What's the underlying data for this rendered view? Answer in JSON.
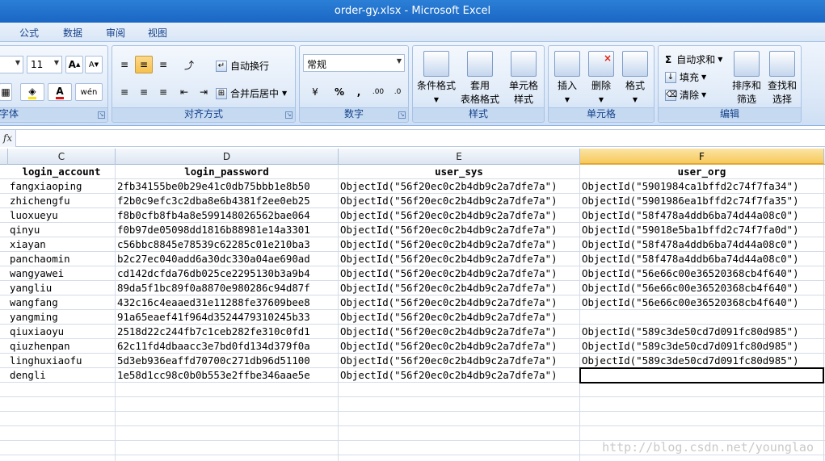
{
  "window": {
    "title": "order-gy.xlsx - Microsoft Excel"
  },
  "tabs": [
    "公式",
    "数据",
    "审阅",
    "视图"
  ],
  "ribbon": {
    "font": {
      "label": "字体",
      "size": "11"
    },
    "alignment": {
      "label": "对齐方式",
      "wrap_text": "自动换行",
      "merge_center": "合并后居中"
    },
    "number": {
      "label": "数字",
      "format": "常规"
    },
    "styles": {
      "label": "样式",
      "conditional": "条件格式",
      "table_format_1": "套用",
      "table_format_2": "表格格式",
      "cell_styles_1": "单元格",
      "cell_styles_2": "样式"
    },
    "cells": {
      "label": "单元格",
      "insert": "插入",
      "delete": "删除",
      "format": "格式"
    },
    "editing": {
      "label": "编辑",
      "autosum": "自动求和",
      "fill": "填充",
      "clear": "清除",
      "sort_filter_1": "排序和",
      "sort_filter_2": "筛选",
      "find_select_1": "查找和",
      "find_select_2": "选择"
    }
  },
  "formula_bar": {
    "fx": "fx",
    "content": ""
  },
  "columns": [
    "C",
    "D",
    "E",
    "F"
  ],
  "active_column": "F",
  "header_row": [
    "login_account",
    "login_password",
    "user_sys",
    "user_org"
  ],
  "rows": [
    [
      "fangxiaoping",
      "2fb34155be0b29e41c0db75bbb1e8b50",
      "ObjectId(\"56f20ec0c2b4db9c2a7dfe7a\")",
      "ObjectId(\"5901984ca1bffd2c74f7fa34\")"
    ],
    [
      "zhichengfu",
      "f2b0c9efc3c2dba8e6b4381f2ee0eb25",
      "ObjectId(\"56f20ec0c2b4db9c2a7dfe7a\")",
      "ObjectId(\"5901986ea1bffd2c74f7fa35\")"
    ],
    [
      "luoxueyu",
      "f8b0cfb8fb4a8e599148026562bae064",
      "ObjectId(\"56f20ec0c2b4db9c2a7dfe7a\")",
      "ObjectId(\"58f478a4ddb6ba74d44a08c0\")"
    ],
    [
      "qinyu",
      "f0b97de05098dd1816b88981e14a3301",
      "ObjectId(\"56f20ec0c2b4db9c2a7dfe7a\")",
      "ObjectId(\"59018e5ba1bffd2c74f7fa0d\")"
    ],
    [
      "xiayan",
      "c56bbc8845e78539c62285c01e210ba3",
      "ObjectId(\"56f20ec0c2b4db9c2a7dfe7a\")",
      "ObjectId(\"58f478a4ddb6ba74d44a08c0\")"
    ],
    [
      "panchaomin",
      "b2c27ec040add6a30dc330a04ae690ad",
      "ObjectId(\"56f20ec0c2b4db9c2a7dfe7a\")",
      "ObjectId(\"58f478a4ddb6ba74d44a08c0\")"
    ],
    [
      "wangyawei",
      "cd142dcfda76db025ce2295130b3a9b4",
      "ObjectId(\"56f20ec0c2b4db9c2a7dfe7a\")",
      "ObjectId(\"56e66c00e36520368cb4f640\")"
    ],
    [
      "yangliu",
      "89da5f1bc89f0a8870e980286c94d87f",
      "ObjectId(\"56f20ec0c2b4db9c2a7dfe7a\")",
      "ObjectId(\"56e66c00e36520368cb4f640\")"
    ],
    [
      "wangfang",
      "432c16c4eaaed31e11288fe37609bee8",
      "ObjectId(\"56f20ec0c2b4db9c2a7dfe7a\")",
      "ObjectId(\"56e66c00e36520368cb4f640\")"
    ],
    [
      "yangming",
      "91a65eaef41f964d3524479310245b33",
      "ObjectId(\"56f20ec0c2b4db9c2a7dfe7a\")",
      ""
    ],
    [
      "qiuxiaoyu",
      "2518d22c244fb7c1ceb282fe310c0fd1",
      "ObjectId(\"56f20ec0c2b4db9c2a7dfe7a\")",
      "ObjectId(\"589c3de50cd7d091fc80d985\")"
    ],
    [
      "qiuzhenpan",
      "62c11fd4dbaacc3e7bd0fd134d379f0a",
      "ObjectId(\"56f20ec0c2b4db9c2a7dfe7a\")",
      "ObjectId(\"589c3de50cd7d091fc80d985\")"
    ],
    [
      "linghuxiaofu",
      "5d3eb936eaffd70700c271db96d51100",
      "ObjectId(\"56f20ec0c2b4db9c2a7dfe7a\")",
      "ObjectId(\"589c3de50cd7d091fc80d985\")"
    ],
    [
      "dengli",
      "1e58d1cc98c0b0b553e2ffbe346aae5e",
      "ObjectId(\"56f20ec0c2b4db9c2a7dfe7a\")",
      ""
    ]
  ],
  "watermark": "http://blog.csdn.net/younglao"
}
